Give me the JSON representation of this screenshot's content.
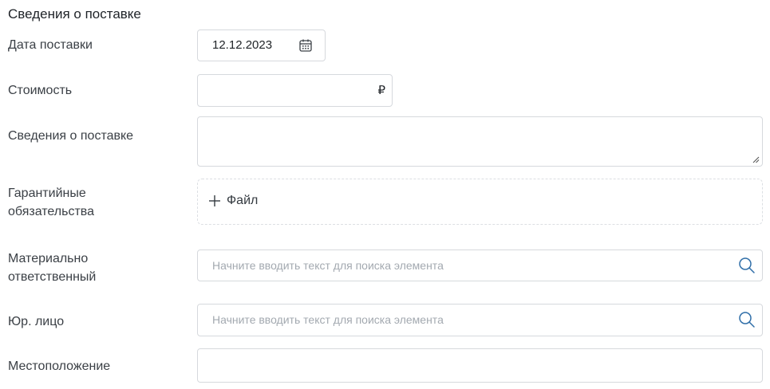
{
  "section": {
    "title": "Сведения о поставке"
  },
  "rows": {
    "delivery_date": {
      "label": "Дата поставки",
      "value": "12.12.2023",
      "icon": "calendar-icon"
    },
    "cost": {
      "label": "Стоимость",
      "value": "",
      "currency": "₽"
    },
    "delivery_info": {
      "label": "Сведения о поставке",
      "value": ""
    },
    "warranty": {
      "label_line1": "Гарантийные",
      "label_line2": "обязательства",
      "add_file_label": "Файл",
      "icon": "plus-icon"
    },
    "responsible": {
      "label_line1": "Материально",
      "label_line2": "ответственный",
      "placeholder": "Начните вводить текст для поиска элемента",
      "icon": "search-icon"
    },
    "legal_entity": {
      "label": "Юр. лицо",
      "placeholder": "Начните вводить текст для поиска элемента",
      "icon": "search-icon"
    },
    "location": {
      "label": "Местоположение",
      "value": ""
    }
  },
  "colors": {
    "accent_icon": "#2f6ea8",
    "border": "#d6d9dd",
    "placeholder": "#a3a9b0"
  }
}
